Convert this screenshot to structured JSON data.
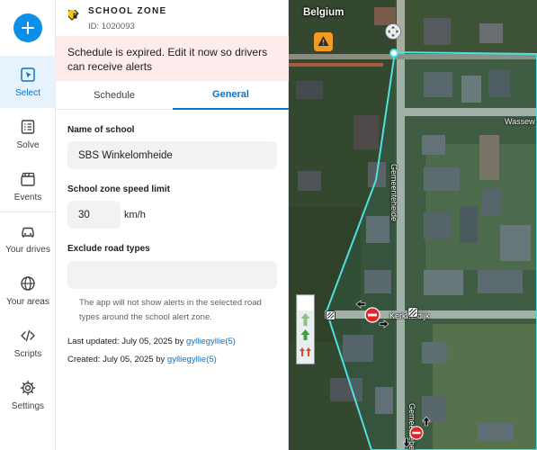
{
  "rail": {
    "add_label": "+",
    "items": [
      {
        "label": "Select"
      },
      {
        "label": "Solve"
      },
      {
        "label": "Events"
      },
      {
        "label": "Your drives"
      },
      {
        "label": "Your areas"
      },
      {
        "label": "Scripts"
      },
      {
        "label": "Settings"
      }
    ]
  },
  "header": {
    "title": "SCHOOL ZONE",
    "id_text": "ID: 1020093"
  },
  "alert": {
    "text": "Schedule is expired. Edit it now so drivers can receive alerts"
  },
  "tabs": [
    {
      "label": "Schedule",
      "active": false
    },
    {
      "label": "General",
      "active": true
    }
  ],
  "form": {
    "school_name_label": "Name of school",
    "school_name_value": "SBS Winkelomheide",
    "speed_limit_label": "School zone speed limit",
    "speed_limit_value": "30",
    "speed_units": "km/h",
    "exclude_label": "Exclude road types",
    "exclude_value": "",
    "hint": "The app will not show alerts in the selected road types around the school alert zone."
  },
  "meta": {
    "updated_prefix": "Last updated: July 05, 2025 by ",
    "updated_user": "gylliegyllie(5)",
    "created_prefix": "Created: July 05, 2025 by ",
    "created_user": "gylliegyllie(5)"
  },
  "map": {
    "country": "Belgium",
    "streets": [
      "Wassew",
      "Gemeenteheide",
      "Kerkhofdijk",
      "Gemeenteheide"
    ]
  },
  "colors": {
    "accent": "#0b8fe8",
    "active_blue": "#0b73c9",
    "alert_bg": "#fdeceb",
    "zone_outline": "#4fe0e0",
    "warning": "#f29b1d"
  }
}
